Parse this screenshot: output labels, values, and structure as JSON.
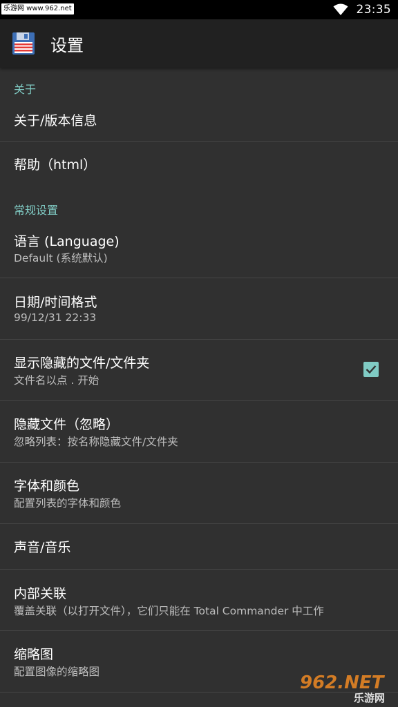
{
  "status_bar": {
    "watermark": "乐游网 www.962.net",
    "time": "23:35",
    "wifi_icon": "wifi-icon"
  },
  "app_bar": {
    "icon": "floppy-disk-icon",
    "title": "设置"
  },
  "sections": {
    "about": {
      "header": "关于",
      "items": [
        {
          "title": "关于/版本信息"
        },
        {
          "title": "帮助（html）"
        }
      ]
    },
    "general": {
      "header": "常规设置",
      "items": [
        {
          "title": "语言 (Language)",
          "summary": "Default (系统默认)"
        },
        {
          "title": "日期/时间格式",
          "summary": "99/12/31  22:33"
        },
        {
          "title": "显示隐藏的文件/文件夹",
          "summary": "文件名以点 . 开始",
          "checked": true
        },
        {
          "title": "隐藏文件（忽略）",
          "summary": "忽略列表：按名称隐藏文件/文件夹"
        },
        {
          "title": "字体和颜色",
          "summary": "配置列表的字体和颜色"
        },
        {
          "title": "声音/音乐"
        },
        {
          "title": "内部关联",
          "summary": "覆盖关联（以打开文件），它们只能在 Total Commander 中工作"
        },
        {
          "title": "缩略图",
          "summary": "配置图像的缩略图"
        }
      ]
    }
  },
  "watermark_logo": {
    "big": "962.NET",
    "small": "乐游网"
  },
  "colors": {
    "accent": "#80cbc4",
    "background": "#303030",
    "app_bar": "#212121"
  }
}
